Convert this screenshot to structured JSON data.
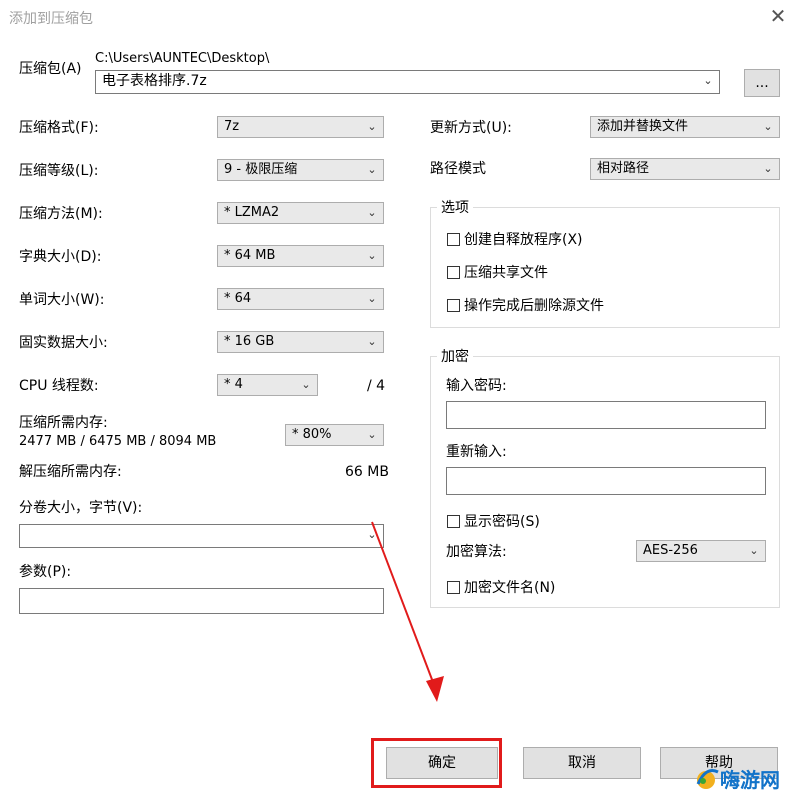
{
  "window": {
    "title": "添加到压缩包"
  },
  "archive": {
    "label": "压缩包(A)",
    "path": "C:\\Users\\AUNTEC\\Desktop\\",
    "filename": "电子表格排序.7z",
    "browse_label": "..."
  },
  "left": {
    "format_label": "压缩格式(F):",
    "format_value": "7z",
    "level_label": "压缩等级(L):",
    "level_value": "9 - 极限压缩",
    "method_label": "压缩方法(M):",
    "method_value": "* LZMA2",
    "dict_label": "字典大小(D):",
    "dict_value": "* 64 MB",
    "word_label": "单词大小(W):",
    "word_value": "* 64",
    "solid_label": "固实数据大小:",
    "solid_value": "* 16 GB",
    "cpu_label": "CPU 线程数:",
    "cpu_value": "* 4",
    "cpu_total": "/ 4",
    "mem_label": "压缩所需内存:",
    "mem_values": "2477 MB / 6475 MB / 8094 MB",
    "mem_percent": "* 80%",
    "decomp_label": "解压缩所需内存:",
    "decomp_value": "66 MB",
    "split_label": "分卷大小，字节(V):",
    "split_value": "",
    "params_label": "参数(P):",
    "params_value": ""
  },
  "right": {
    "update_label": "更新方式(U):",
    "update_value": "添加并替换文件",
    "path_mode_label": "路径模式",
    "path_mode_value": "相对路径",
    "options": {
      "title": "选项",
      "sfx": "创建自释放程序(X)",
      "shared": "压缩共享文件",
      "delete": "操作完成后删除源文件"
    },
    "encryption": {
      "title": "加密",
      "password_label": "输入密码:",
      "reenter_label": "重新输入:",
      "show_password": "显示密码(S)",
      "method_label": "加密算法:",
      "method_value": "AES-256",
      "encrypt_names": "加密文件名(N)"
    }
  },
  "buttons": {
    "ok": "确定",
    "cancel": "取消",
    "help": "帮助"
  },
  "watermark": {
    "text": "嗨游网"
  },
  "colors": {
    "annotation": "#e11b1b",
    "watermark": "#1273c9"
  }
}
